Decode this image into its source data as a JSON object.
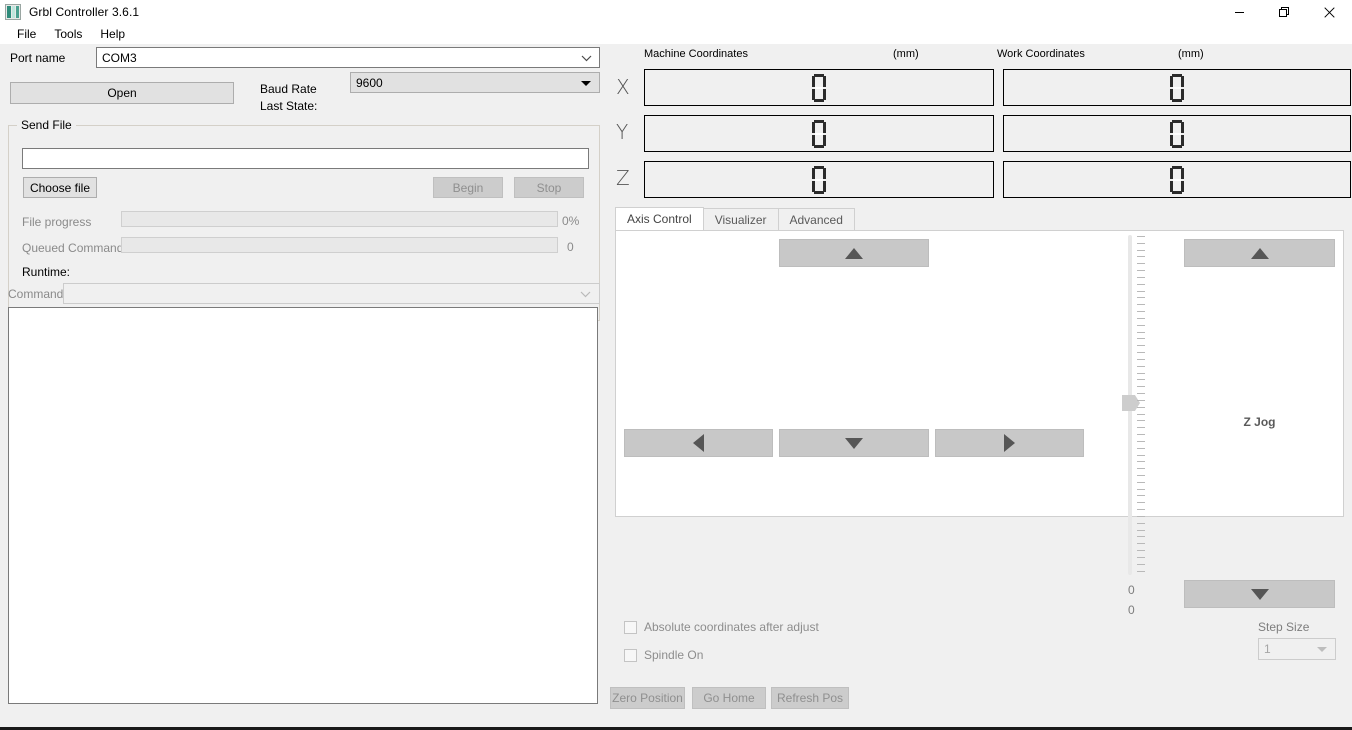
{
  "window": {
    "title": "Grbl Controller 3.6.1",
    "icon": "app-icon",
    "minimize": "minimize-icon",
    "maximize": "restore-icon",
    "close": "close-icon"
  },
  "menubar": {
    "items": [
      {
        "label": "File"
      },
      {
        "label": "Tools"
      },
      {
        "label": "Help"
      }
    ]
  },
  "connection": {
    "port_label": "Port name",
    "port_value": "COM3",
    "open_button": "Open",
    "baud_label": "Baud Rate",
    "baud_value": "9600",
    "last_state_label": "Last State:",
    "last_state_value": ""
  },
  "send_file": {
    "group_title": "Send File",
    "file_path_value": "",
    "choose_file_button": "Choose file",
    "begin_button": "Begin",
    "stop_button": "Stop",
    "file_progress_label": "File progress",
    "file_progress_value": "0%",
    "file_progress_percent": 0,
    "queued_label": "Queued Commands",
    "queued_value": "0",
    "queued_percent": 0,
    "runtime_label": "Runtime:",
    "runtime_value": ""
  },
  "command": {
    "label": "Command",
    "value": ""
  },
  "console": {
    "value": ""
  },
  "coordinates": {
    "machine_header": "Machine Coordinates",
    "machine_units": "(mm)",
    "work_header": "Work Coordinates",
    "work_units": "(mm)",
    "rows": [
      {
        "axis": "X",
        "machine": "0",
        "work": "0"
      },
      {
        "axis": "Y",
        "machine": "0",
        "work": "0"
      },
      {
        "axis": "Z",
        "machine": "0",
        "work": "0"
      }
    ]
  },
  "tabs": [
    {
      "label": "Axis Control",
      "active": true
    },
    {
      "label": "Visualizer",
      "active": false
    },
    {
      "label": "Advanced",
      "active": false
    }
  ],
  "axis_control": {
    "xy_up": "triangle-up-icon",
    "xy_down": "triangle-down-icon",
    "xy_left": "triangle-left-icon",
    "xy_right": "triangle-right-icon",
    "z_jog_label": "Z Jog",
    "z_up": "triangle-up-icon",
    "z_down": "triangle-down-icon",
    "slider_value_top": "0",
    "slider_value_bottom": "0",
    "step_size_label": "Step Size",
    "step_size_value": "1",
    "absolute_checkbox": "Absolute coordinates after adjust",
    "absolute_checked": false,
    "spindle_checkbox": "Spindle On",
    "spindle_checked": false
  },
  "bottom_buttons": [
    {
      "label": "Zero Position"
    },
    {
      "label": "Go Home"
    },
    {
      "label": "Refresh Pos"
    }
  ],
  "colors": {
    "window_bg": "#f0f0f0",
    "button_face": "#e1e1e1",
    "jog_button": "#c8c8c8",
    "accent_icon": "#2e8b7a"
  }
}
